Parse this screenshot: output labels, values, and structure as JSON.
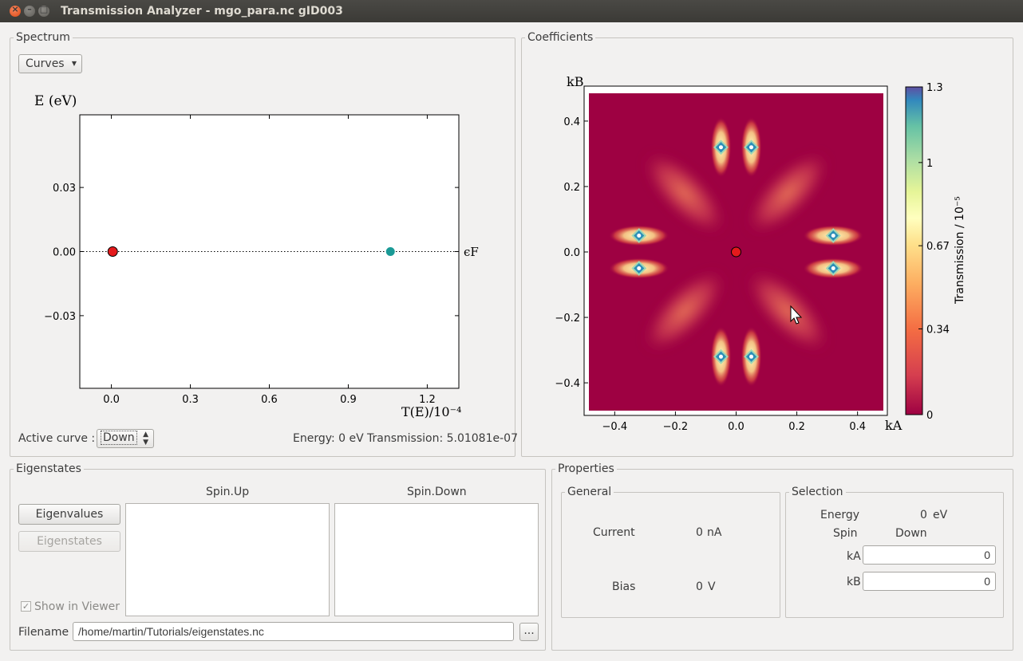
{
  "window": {
    "title": "Transmission Analyzer - mgo_para.nc gID003"
  },
  "spectrum": {
    "group_label": "Spectrum",
    "view_combo": "Curves",
    "active_curve_label": "Active curve :",
    "active_curve_value": "Down",
    "energy_readout": "Energy: 0 eV",
    "transmission_readout": "Transmission: 5.01081e-07",
    "fermi_label": "ϵF"
  },
  "coefficients": {
    "group_label": "Coefficients"
  },
  "chart_data": [
    {
      "type": "scatter",
      "title": "",
      "xlabel": "T(E)/10⁻⁴",
      "ylabel": "E (eV)",
      "xlim": [
        -0.12,
        1.32
      ],
      "ylim": [
        -0.064,
        0.064
      ],
      "xticks": [
        "0.0",
        "0.3",
        "0.6",
        "0.9",
        "1.2"
      ],
      "xtick_values": [
        0,
        0.3,
        0.6,
        0.9,
        1.2
      ],
      "yticks": [
        "0.03",
        "0.00",
        "−0.03"
      ],
      "ytick_values": [
        0.03,
        0,
        -0.03
      ],
      "fermi_line_y": 0,
      "series": [
        {
          "color": "#e41a1c",
          "points": [
            [
              0.005,
              0
            ]
          ]
        },
        {
          "color": "#1a9a96",
          "points": [
            [
              1.06,
              0
            ]
          ]
        }
      ],
      "grid": false
    },
    {
      "type": "heatmap",
      "title": "",
      "xlabel": "kA",
      "ylabel": "kB",
      "xlim": [
        -0.5,
        0.5
      ],
      "ylim": [
        -0.5,
        0.5
      ],
      "xticks": [
        "−0.4",
        "−0.2",
        "0.0",
        "0.2",
        "0.4"
      ],
      "xtick_values": [
        -0.4,
        -0.2,
        0,
        0.2,
        0.4
      ],
      "yticks": [
        "0.4",
        "0.2",
        "0.0",
        "−0.2",
        "−0.4"
      ],
      "ytick_values": [
        0.4,
        0.2,
        0,
        -0.2,
        -0.4
      ],
      "colorbar": {
        "label": "Transmission / 10⁻⁵",
        "ticks": [
          "1.3",
          "1",
          "0.67",
          "0.34",
          "0"
        ],
        "tick_values": [
          1.3,
          1.0,
          0.67,
          0.34,
          0
        ],
        "range": [
          0,
          1.3
        ],
        "colormap": "Spectral"
      },
      "hotspots": [
        {
          "x": -0.05,
          "y": 0.32
        },
        {
          "x": 0.05,
          "y": 0.32
        },
        {
          "x": -0.05,
          "y": -0.32
        },
        {
          "x": 0.05,
          "y": -0.32
        },
        {
          "x": -0.32,
          "y": 0.05
        },
        {
          "x": -0.32,
          "y": -0.05
        },
        {
          "x": 0.32,
          "y": 0.05
        },
        {
          "x": 0.32,
          "y": -0.05
        }
      ],
      "selected_point": {
        "x": 0,
        "y": 0,
        "color": "#e41a1c"
      },
      "background_color": "#9e0142"
    }
  ],
  "eigenstates": {
    "group_label": "Eigenstates",
    "spin_up_label": "Spin.Up",
    "spin_down_label": "Spin.Down",
    "eigenvalues_button": "Eigenvalues",
    "eigenstates_button": "Eigenstates",
    "show_in_viewer_label": "Show in Viewer",
    "show_in_viewer_checked": true,
    "filename_label": "Filename",
    "filename_value": "/home/martin/Tutorials/eigenstates.nc",
    "browse_button": "..."
  },
  "properties": {
    "group_label": "Properties",
    "general": {
      "group_label": "General",
      "current_label": "Current",
      "current_value": "0",
      "current_unit": "nA",
      "bias_label": "Bias",
      "bias_value": "0",
      "bias_unit": "V"
    },
    "selection": {
      "group_label": "Selection",
      "energy_label": "Energy",
      "energy_value": "0",
      "energy_unit": "eV",
      "spin_label": "Spin",
      "spin_value": "Down",
      "ka_label": "kA",
      "ka_value": "0",
      "kb_label": "kB",
      "kb_value": "0"
    }
  }
}
